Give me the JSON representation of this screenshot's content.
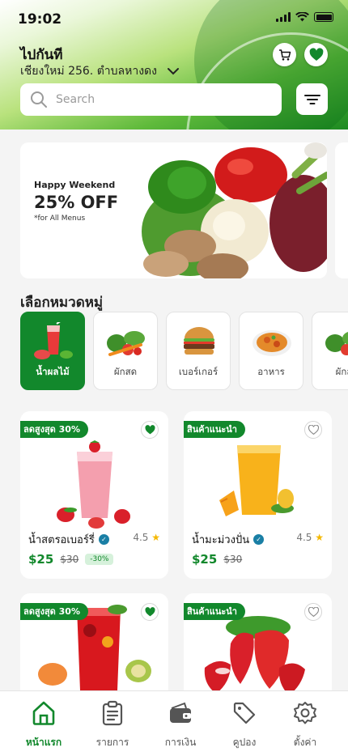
{
  "status_bar": {
    "time": "19:02"
  },
  "header": {
    "location_title": "ไปกันที",
    "address": "เชียงใหม่ 256. ตำบลหางดง",
    "cart_icon": "cart-icon",
    "favorite_icon": "heart-icon"
  },
  "search": {
    "placeholder": "Search",
    "value": ""
  },
  "banner": {
    "subtitle": "Happy Weekend",
    "headline": "25% OFF",
    "note": "*for All Menus"
  },
  "categories_title": "เลือกหมวดหมู่",
  "categories": [
    {
      "label": "น้ำผลไม้",
      "active": true
    },
    {
      "label": "ผักสด",
      "active": false
    },
    {
      "label": "เบอร์เกอร์",
      "active": false
    },
    {
      "label": "อาหาร",
      "active": false
    },
    {
      "label": "ผักส",
      "active": false
    }
  ],
  "products": [
    {
      "tag": "ลดสูงสุด 30%",
      "name": "น้ำสตรอเบอร์รี่",
      "rating": "4.5",
      "price": "$25",
      "old_price": "$30",
      "discount": "-30%",
      "favorited": true
    },
    {
      "tag": "สินค้าแนะนำ",
      "name": "น้ำมะม่วงปั่น",
      "rating": "4.5",
      "price": "$25",
      "old_price": "$30",
      "favorited": false
    },
    {
      "tag": "ลดสูงสุด 30%",
      "favorited": true
    },
    {
      "tag": "สินค้าแนะนำ",
      "favorited": false
    }
  ],
  "nav": [
    {
      "label": "หน้าแรก",
      "icon": "home-icon",
      "active": true
    },
    {
      "label": "รายการ",
      "icon": "clipboard-icon",
      "active": false
    },
    {
      "label": "การเงิน",
      "icon": "wallet-icon",
      "active": false
    },
    {
      "label": "คูปอง",
      "icon": "tag-icon",
      "active": false
    },
    {
      "label": "ตั้งค่า",
      "icon": "gear-icon",
      "active": false
    }
  ],
  "colors": {
    "primary": "#12882c",
    "star": "#f5b800",
    "verified": "#1a7fa5"
  }
}
